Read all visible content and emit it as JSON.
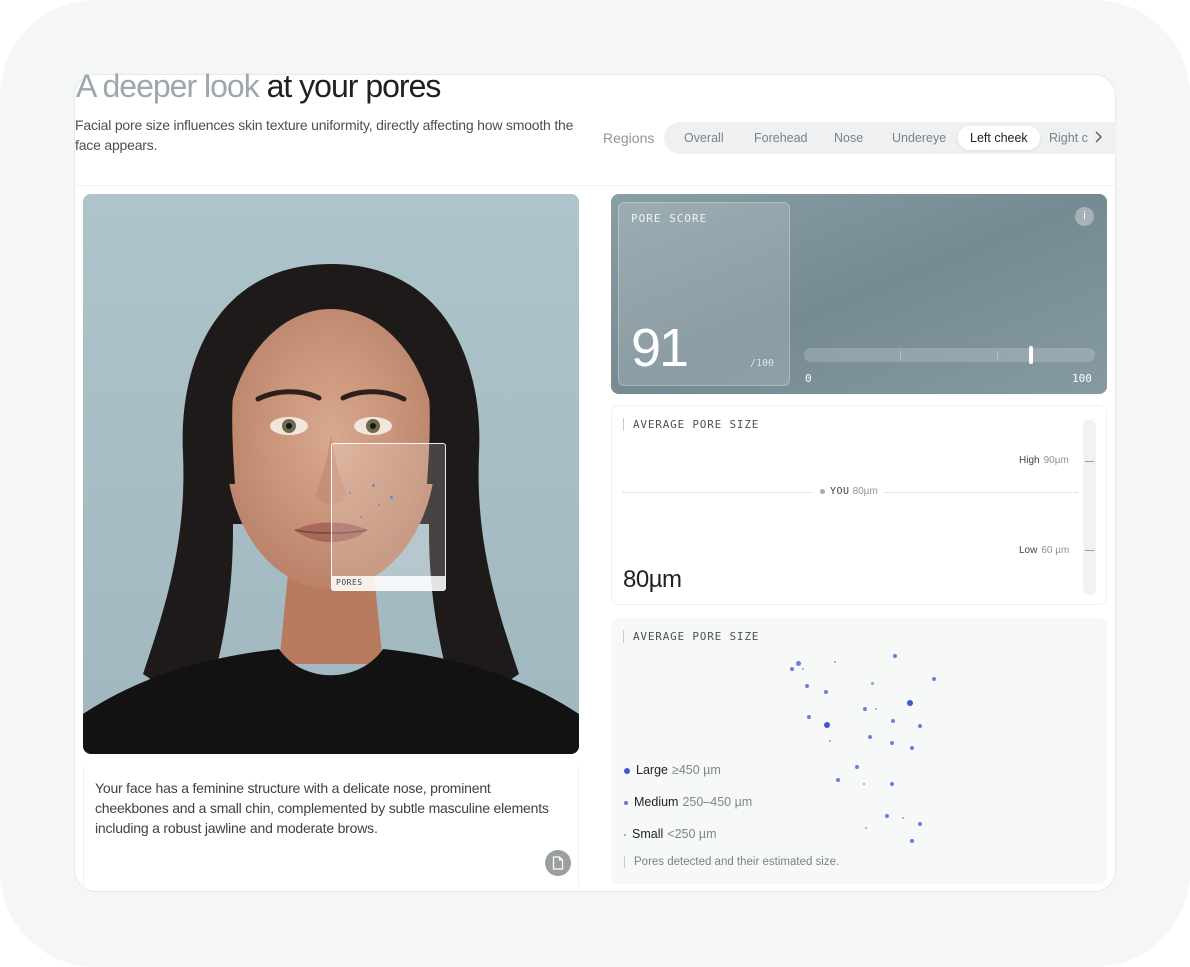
{
  "header": {
    "title_muted": "A deeper look",
    "title_strong": " at your pores",
    "subtitle": "Facial pore size influences skin texture uniformity, directly affecting how smooth the face appears."
  },
  "regions": {
    "label": "Regions",
    "tabs": [
      "Overall",
      "Forehead",
      "Nose",
      "Undereye",
      "Left cheek",
      "Right c"
    ],
    "active_tab": "Left cheek"
  },
  "photo": {
    "overlay_tag": "PORES"
  },
  "description": {
    "text": "Your face has a feminine structure with a delicate nose, prominent cheekbones and a small chin, complemented by subtle masculine elements including a robust jawline and moderate brows."
  },
  "pore_score": {
    "label": "PORE SCORE",
    "value": "91",
    "max_text": "/100",
    "info_glyph": "i",
    "slider_min": "0",
    "slider_max": "100",
    "slider_value": 0.78
  },
  "average_size": {
    "label": "AVERAGE PORE SIZE",
    "high_label": "High",
    "high_value": "90µm",
    "low_label": "Low",
    "low_value": "60 µm",
    "you_label": "YOU",
    "you_value": "80µm",
    "value": "80µm"
  },
  "distribution": {
    "label": "AVERAGE PORE SIZE",
    "legend": [
      {
        "name": "Large",
        "range": "≥450 µm"
      },
      {
        "name": "Medium",
        "range": "250–450 µm"
      },
      {
        "name": "Small",
        "range": "<250 µm"
      }
    ],
    "note": "Pores detected and their estimated size.",
    "dot_color": "#3b57d6"
  },
  "colors": {
    "accent": "#3b57d6",
    "photo_bg": "#a9bfc6"
  }
}
